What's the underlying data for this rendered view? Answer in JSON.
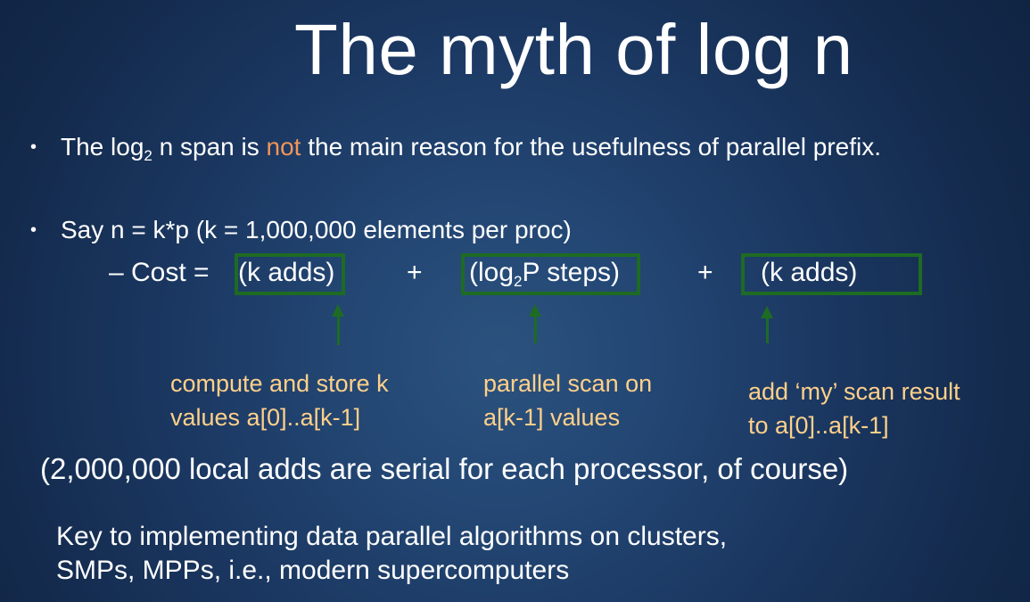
{
  "slide": {
    "title": "The myth of log n",
    "bullet1": {
      "pre": "The log",
      "sub": "2",
      "post_a": " n span is ",
      "highlight": "not",
      "post_b": " the main reason for the usefulness of parallel prefix."
    },
    "bullet2": "Say n = k*p (k = 1,000,000 elements per proc)",
    "cost": {
      "prefix": "– Cost = ",
      "term1": "(k adds)",
      "plus1": "+",
      "term2_pre": "(log",
      "term2_sub": "2",
      "term2_post": "P steps)",
      "plus2": "+",
      "term3": "(k adds)"
    },
    "notes": {
      "n1_line1": "compute and store k",
      "n1_line2": "values a[0]..a[k-1]",
      "n2_line1": "parallel scan on",
      "n2_line2": "a[k-1] values",
      "n3_line1": "add ‘my’ scan result",
      "n3_line2": "to a[0]..a[k-1]"
    },
    "serial_note": "(2,000,000 local adds are serial for each processor, of course)",
    "key_line1": "Key to implementing data parallel algorithms on clusters,",
    "key_line2": "SMPs, MPPs, i.e., modern supercomputers"
  },
  "colors": {
    "highlight": "#f2955a",
    "box_green": "#1e6b23",
    "note_text": "#ffd08a"
  }
}
